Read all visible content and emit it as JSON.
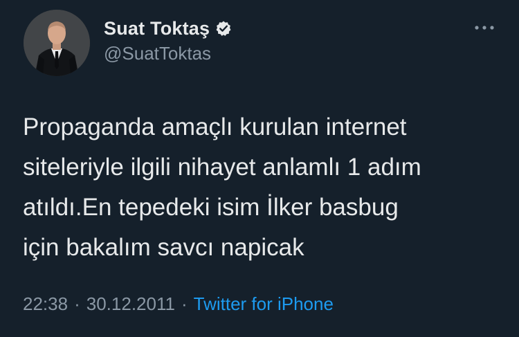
{
  "author": {
    "display_name": "Suat Toktaş",
    "handle": "@SuatToktas",
    "verified": true
  },
  "tweet": {
    "text": "Propaganda amaçlı kurulan internet\nsiteleriyle ilgili nihayet anlamlı 1 adım\natıldı.En tepedeki isim İlker basbug\niçin bakalım savcı napicak",
    "time": "22:38",
    "separator": "·",
    "date": "30.12.2011",
    "source": "Twitter for iPhone"
  },
  "colors": {
    "background": "#15202b",
    "primary_text": "#e7e9ea",
    "secondary_text": "#8b98a5",
    "accent": "#1d9bf0"
  },
  "icons": {
    "verified": "verified-badge-icon",
    "more": "more-horizontal-icon"
  }
}
